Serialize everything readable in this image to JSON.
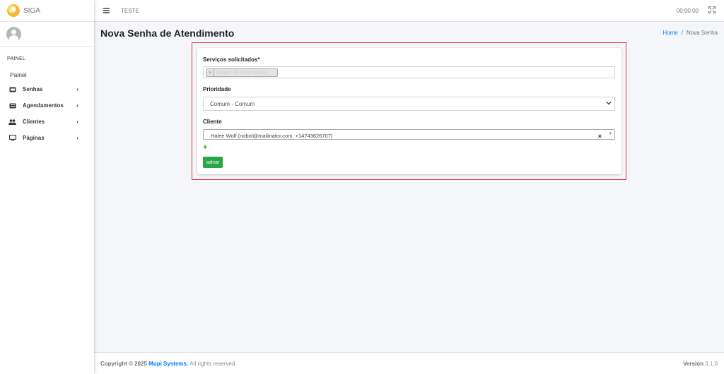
{
  "brand": {
    "name": "SIGA"
  },
  "sidebar": {
    "header": "PAINEL",
    "simple": "Painel",
    "items": [
      {
        "label": "Senhas",
        "icon": "ticket-icon"
      },
      {
        "label": "Agendamentos",
        "icon": "list-icon"
      },
      {
        "label": "Clientes",
        "icon": "users-icon"
      },
      {
        "label": "Páginas",
        "icon": "desktop-icon"
      }
    ]
  },
  "topbar": {
    "title": "TESTE",
    "timer": "00:00:00"
  },
  "page": {
    "title": "Nova Senha de Atendimento"
  },
  "breadcrumb": {
    "home": "Home",
    "sep": "/",
    "current": "Nova Senha"
  },
  "form": {
    "services_label": "Serviços solicitados*",
    "services_tag": "Viagem de Informações",
    "services_tag_remove": "×",
    "priority_label": "Prioridade",
    "priority_value": "Comum - Comum",
    "client_label": "Cliente",
    "client_value": "Halee Wolf (nobol@mailinator.com, +14743626707)",
    "client_clear": "×",
    "add": "+",
    "save_label": "salvar"
  },
  "footer": {
    "copyright": "Copyright © 2025",
    "company": "Mupi Systems.",
    "rights": "All rights reserved.",
    "version_label": "Version",
    "version_value": "3.1.0"
  },
  "colors": {
    "primary": "#007bff",
    "success": "#28a745",
    "highlight": "#e6323a"
  }
}
